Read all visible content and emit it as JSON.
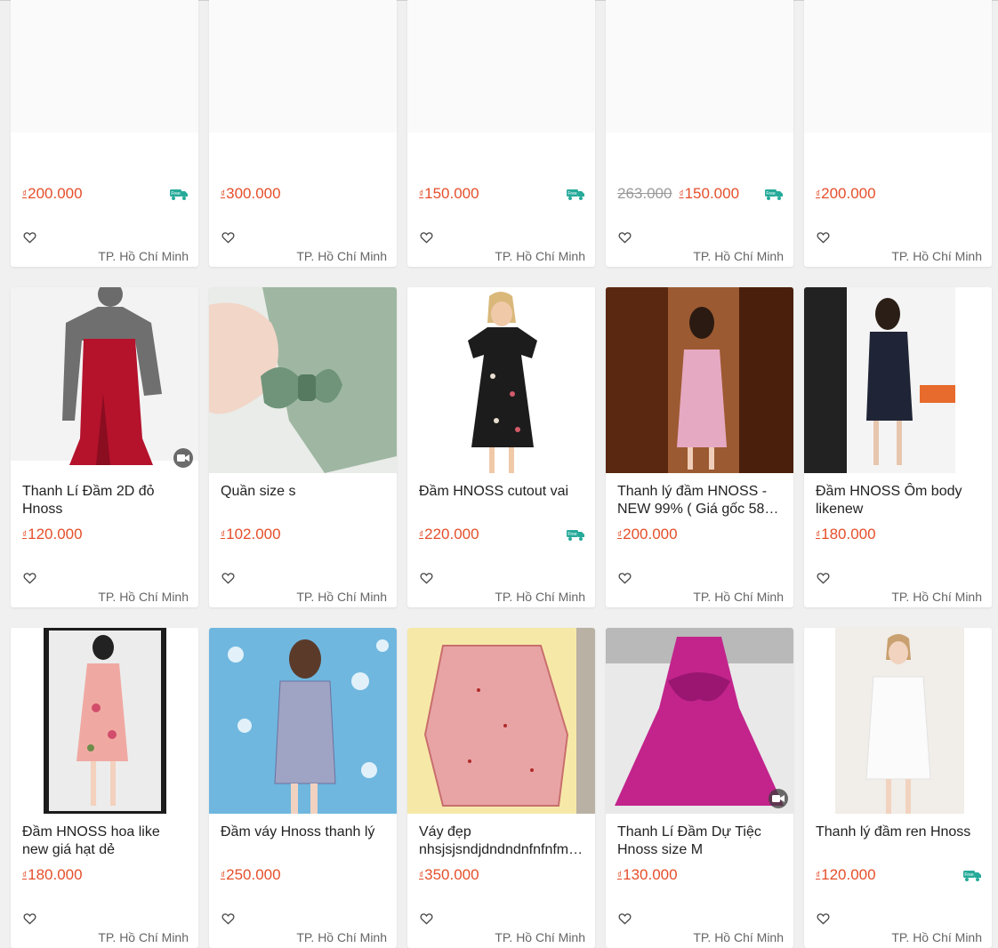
{
  "currency_symbol": "₫",
  "cards": [
    {
      "title": "",
      "price": "200.000",
      "old_price": "",
      "location": "TP. Hồ Chí Minh",
      "free_ship": true,
      "video": false,
      "photo": "none"
    },
    {
      "title": "",
      "price": "300.000",
      "old_price": "",
      "location": "TP. Hồ Chí Minh",
      "free_ship": false,
      "video": false,
      "photo": "none"
    },
    {
      "title": "",
      "price": "150.000",
      "old_price": "",
      "location": "TP. Hồ Chí Minh",
      "free_ship": true,
      "video": false,
      "photo": "none"
    },
    {
      "title": "",
      "price": "150.000",
      "old_price": "263.000",
      "location": "TP. Hồ Chí Minh",
      "free_ship": true,
      "video": false,
      "photo": "none"
    },
    {
      "title": "",
      "price": "200.000",
      "old_price": "",
      "location": "TP. Hồ Chí Minh",
      "free_ship": false,
      "video": false,
      "photo": "none"
    },
    {
      "title": "Thanh Lí Đầm 2D đỏ Hnoss",
      "price": "120.000",
      "old_price": "",
      "location": "TP. Hồ Chí Minh",
      "free_ship": false,
      "video": true,
      "photo": "red-dress"
    },
    {
      "title": "Quần size s",
      "price": "102.000",
      "old_price": "",
      "location": "TP. Hồ Chí Minh",
      "free_ship": false,
      "video": false,
      "photo": "green-bow"
    },
    {
      "title": "Đầm HNOSS cutout vai",
      "price": "220.000",
      "old_price": "",
      "location": "TP. Hồ Chí Minh",
      "free_ship": true,
      "video": false,
      "photo": "floral-black"
    },
    {
      "title": "Thanh lý đầm HNOSS - NEW 99% ( Giá gốc 58…",
      "price": "200.000",
      "old_price": "",
      "location": "TP. Hồ Chí Minh",
      "free_ship": false,
      "video": false,
      "photo": "pink-door"
    },
    {
      "title": "Đầm HNOSS Ôm body likenew",
      "price": "180.000",
      "old_price": "",
      "location": "TP. Hồ Chí Minh",
      "free_ship": false,
      "video": false,
      "photo": "black-mirror"
    },
    {
      "title": "Đầm HNOSS hoa like new giá hạt dẻ",
      "price": "180.000",
      "old_price": "",
      "location": "TP. Hồ Chí Minh",
      "free_ship": false,
      "video": false,
      "photo": "floral-pink"
    },
    {
      "title": "Đầm váy Hnoss thanh lý",
      "price": "250.000",
      "old_price": "",
      "location": "TP. Hồ Chí Minh",
      "free_ship": false,
      "video": false,
      "photo": "plaid-blue"
    },
    {
      "title": "Váy đẹp nhsjsjsndjdndndnfnfnfm…",
      "price": "350.000",
      "old_price": "",
      "location": "TP. Hồ Chí Minh",
      "free_ship": false,
      "video": false,
      "photo": "red-print"
    },
    {
      "title": "Thanh Lí Đầm Dự Tiệc Hnoss size M",
      "price": "130.000",
      "old_price": "",
      "location": "TP. Hồ Chí Minh",
      "free_ship": false,
      "video": true,
      "photo": "magenta"
    },
    {
      "title": "Thanh lý đầm ren Hnoss",
      "price": "120.000",
      "old_price": "",
      "location": "TP. Hồ Chí Minh",
      "free_ship": true,
      "video": false,
      "photo": "white-dress"
    }
  ],
  "colors": {
    "price": "#e54f2b",
    "free_ship": "#26aa99",
    "text": "#222222",
    "muted": "#666666"
  }
}
